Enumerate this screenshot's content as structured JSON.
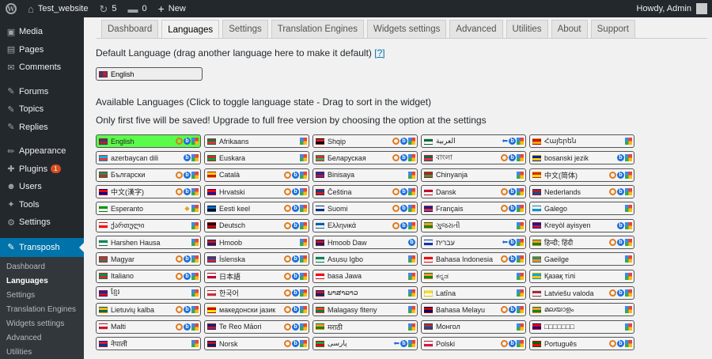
{
  "adminbar": {
    "site": "Test_website",
    "updates": "5",
    "comments": "0",
    "new": "New",
    "howdy": "Howdy, Admin"
  },
  "sidebar": {
    "items": [
      {
        "label": "Media",
        "icon": "media-icon",
        "glyph": "▣"
      },
      {
        "label": "Pages",
        "icon": "pages-icon",
        "glyph": "▤"
      },
      {
        "label": "Comments",
        "icon": "comments-icon",
        "glyph": "✉"
      },
      {
        "sep": true
      },
      {
        "label": "Forums",
        "icon": "forums-icon",
        "glyph": "✎"
      },
      {
        "label": "Topics",
        "icon": "topics-icon",
        "glyph": "✎"
      },
      {
        "label": "Replies",
        "icon": "replies-icon",
        "glyph": "✎"
      },
      {
        "sep": true
      },
      {
        "label": "Appearance",
        "icon": "appearance-icon",
        "glyph": "✏"
      },
      {
        "label": "Plugins",
        "icon": "plugins-icon",
        "glyph": "✚",
        "badge": "1"
      },
      {
        "label": "Users",
        "icon": "users-icon",
        "glyph": "☻"
      },
      {
        "label": "Tools",
        "icon": "tools-icon",
        "glyph": "✦"
      },
      {
        "label": "Settings",
        "icon": "settings-icon",
        "glyph": "⚙"
      },
      {
        "sep": true
      },
      {
        "label": "Transposh",
        "icon": "transposh-icon",
        "glyph": "✎",
        "current": true
      }
    ],
    "submenu": [
      {
        "label": "Dashboard"
      },
      {
        "label": "Languages",
        "current": true
      },
      {
        "label": "Settings"
      },
      {
        "label": "Translation Engines"
      },
      {
        "label": "Widgets settings"
      },
      {
        "label": "Advanced"
      },
      {
        "label": "Utilities"
      }
    ]
  },
  "tabs": [
    {
      "label": "Dashboard"
    },
    {
      "label": "Languages",
      "active": true
    },
    {
      "label": "Settings"
    },
    {
      "label": "Translation Engines"
    },
    {
      "label": "Widgets settings"
    },
    {
      "label": "Advanced"
    },
    {
      "label": "Utilities"
    },
    {
      "label": "About"
    },
    {
      "label": "Support"
    }
  ],
  "main": {
    "default_heading": "Default Language (drag another language here to make it default)",
    "default_help": "[?]",
    "default_language": "English",
    "available_heading": "Available Languages (Click to toggle language state - Drag to sort in the widget)",
    "notice": "Only first five will be saved! Upgrade to full free version by choosing the option at the settings"
  },
  "languages": [
    {
      "name": "English",
      "flag": [
        "#3c3b6e",
        "#b22234"
      ],
      "eng": "ybg",
      "sel": true
    },
    {
      "name": "Afrikaans",
      "flag": [
        "#007a4d",
        "#de3831"
      ],
      "eng": "g"
    },
    {
      "name": "Shqip",
      "flag": [
        "#e41e20",
        "#000000"
      ],
      "eng": "ybg"
    },
    {
      "name": "العربية",
      "flag": [
        "#006c35",
        "#ffffff"
      ],
      "eng": "rbg"
    },
    {
      "name": "Հայերեն",
      "flag": [
        "#d90012",
        "#f2a800"
      ],
      "eng": "g"
    },
    {
      "name": "azerbaycan dili",
      "flag": [
        "#00b5e2",
        "#ef3340"
      ],
      "eng": "bg"
    },
    {
      "name": "Euskara",
      "flag": [
        "#d52b1e",
        "#009b48"
      ],
      "eng": "g"
    },
    {
      "name": "Беларуская",
      "flag": [
        "#c8313e",
        "#4aa657"
      ],
      "eng": "ybg"
    },
    {
      "name": "বাংলা",
      "flag": [
        "#006a4e",
        "#f42a41"
      ],
      "eng": "ybg"
    },
    {
      "name": "bosanski jezik",
      "flag": [
        "#002395",
        "#fecb00"
      ],
      "eng": "bg"
    },
    {
      "name": "Български",
      "flag": [
        "#00966e",
        "#d62612"
      ],
      "eng": "ybg"
    },
    {
      "name": "Català",
      "flag": [
        "#fcdd09",
        "#da121a"
      ],
      "eng": "ybg"
    },
    {
      "name": "Binisaya",
      "flag": [
        "#0038a8",
        "#ce1126"
      ],
      "eng": "g"
    },
    {
      "name": "Chinyanja",
      "flag": [
        "#ce1126",
        "#339e35"
      ],
      "eng": "g"
    },
    {
      "name": "中文(简体)",
      "flag": [
        "#de2910",
        "#ffde00"
      ],
      "eng": "ybg"
    },
    {
      "name": "中文(漢字)",
      "flag": [
        "#fe0000",
        "#000095"
      ],
      "eng": "ybg"
    },
    {
      "name": "Hrvatski",
      "flag": [
        "#ff0000",
        "#171796"
      ],
      "eng": "ybg"
    },
    {
      "name": "Čeština",
      "flag": [
        "#11457e",
        "#d7141a"
      ],
      "eng": "ybg"
    },
    {
      "name": "Dansk",
      "flag": [
        "#c60c30",
        "#ffffff"
      ],
      "eng": "ybg"
    },
    {
      "name": "Nederlands",
      "flag": [
        "#ae1c28",
        "#21468b"
      ],
      "eng": "ybg"
    },
    {
      "name": "Esperanto",
      "flag": [
        "#009900",
        "#ffffff"
      ],
      "eng": "ag"
    },
    {
      "name": "Eesti keel",
      "flag": [
        "#0072ce",
        "#000000"
      ],
      "eng": "ybg"
    },
    {
      "name": "Suomi",
      "flag": [
        "#ffffff",
        "#003580"
      ],
      "eng": "ybg"
    },
    {
      "name": "Français",
      "flag": [
        "#002395",
        "#ed2939"
      ],
      "eng": "ybg"
    },
    {
      "name": "Galego",
      "flag": [
        "#ffffff",
        "#0099cc"
      ],
      "eng": "g"
    },
    {
      "name": "ქართული",
      "flag": [
        "#ffffff",
        "#ff0000"
      ],
      "eng": "g"
    },
    {
      "name": "Deutsch",
      "flag": [
        "#000000",
        "#dd0000"
      ],
      "eng": "ybg"
    },
    {
      "name": "Ελληνικά",
      "flag": [
        "#0d5eaf",
        "#ffffff"
      ],
      "eng": "ybg"
    },
    {
      "name": "ગુજરાતી",
      "flag": [
        "#ff9933",
        "#138808"
      ],
      "eng": "g"
    },
    {
      "name": "Kreyòl ayisyen",
      "flag": [
        "#00209f",
        "#d21034"
      ],
      "eng": "bg"
    },
    {
      "name": "Harshen Hausa",
      "flag": [
        "#008751",
        "#ffffff"
      ],
      "eng": "g"
    },
    {
      "name": "Hmoob",
      "flag": [
        "#ce1126",
        "#002868"
      ],
      "eng": "g"
    },
    {
      "name": "Hmoob Daw",
      "flag": [
        "#ce1126",
        "#002868"
      ],
      "eng": "b"
    },
    {
      "name": "עברית",
      "flag": [
        "#ffffff",
        "#0038b8"
      ],
      "eng": "rbg"
    },
    {
      "name": "हिन्दी; हिंदी",
      "flag": [
        "#ff9933",
        "#138808"
      ],
      "eng": "ybg"
    },
    {
      "name": "Magyar",
      "flag": [
        "#ce2939",
        "#477050"
      ],
      "eng": "ybg"
    },
    {
      "name": "Íslenska",
      "flag": [
        "#02529c",
        "#dc1e35"
      ],
      "eng": "ybg"
    },
    {
      "name": "Asụsụ Igbo",
      "flag": [
        "#008751",
        "#ffffff"
      ],
      "eng": "g"
    },
    {
      "name": "Bahasa Indonesia",
      "flag": [
        "#ff0000",
        "#ffffff"
      ],
      "eng": "ybg"
    },
    {
      "name": "Gaeilge",
      "flag": [
        "#169b62",
        "#ff883e"
      ],
      "eng": "g"
    },
    {
      "name": "Italiano",
      "flag": [
        "#009246",
        "#ce2b37"
      ],
      "eng": "ybg"
    },
    {
      "name": "日本語",
      "flag": [
        "#ffffff",
        "#bc002d"
      ],
      "eng": "ybg"
    },
    {
      "name": "basa Jawa",
      "flag": [
        "#ff0000",
        "#ffffff"
      ],
      "eng": "g"
    },
    {
      "name": "ಕನ್ನಡ",
      "flag": [
        "#ff9933",
        "#138808"
      ],
      "eng": "g"
    },
    {
      "name": "Қазақ тілі",
      "flag": [
        "#00afca",
        "#fec50c"
      ],
      "eng": "g"
    },
    {
      "name": "ខ្មែរ",
      "flag": [
        "#032ea1",
        "#e00025"
      ],
      "eng": "g"
    },
    {
      "name": "한국어",
      "flag": [
        "#ffffff",
        "#cd2e3a"
      ],
      "eng": "ybg"
    },
    {
      "name": "ພາສາລາວ",
      "flag": [
        "#ce1126",
        "#002868"
      ],
      "eng": "g"
    },
    {
      "name": "Latīna",
      "flag": [
        "#ffe000",
        "#ffffff"
      ],
      "eng": "g"
    },
    {
      "name": "Latviešu valoda",
      "flag": [
        "#9e3039",
        "#ffffff"
      ],
      "eng": "ybg"
    },
    {
      "name": "Lietuvių kalba",
      "flag": [
        "#fdb913",
        "#006a44"
      ],
      "eng": "ybg"
    },
    {
      "name": "македонски јазик",
      "flag": [
        "#d20000",
        "#ffe600"
      ],
      "eng": "ybg"
    },
    {
      "name": "Malagasy fiteny",
      "flag": [
        "#fc3d32",
        "#007e3a"
      ],
      "eng": "g"
    },
    {
      "name": "Bahasa Melayu",
      "flag": [
        "#cc0001",
        "#010066"
      ],
      "eng": "ybg"
    },
    {
      "name": "മലയാളം",
      "flag": [
        "#ff9933",
        "#138808"
      ],
      "eng": "g"
    },
    {
      "name": "Malti",
      "flag": [
        "#ffffff",
        "#cf142b"
      ],
      "eng": "ybg"
    },
    {
      "name": "Te Reo Māori",
      "flag": [
        "#00247d",
        "#cc142b"
      ],
      "eng": "ybg"
    },
    {
      "name": "मराठी",
      "flag": [
        "#ff9933",
        "#138808"
      ],
      "eng": "g"
    },
    {
      "name": "Монгол",
      "flag": [
        "#c4272f",
        "#015197"
      ],
      "eng": "g"
    },
    {
      "name": "□□□□□□□",
      "flag": [
        "#fe0000",
        "#000095"
      ],
      "eng": "g"
    },
    {
      "name": "नेपाली",
      "flag": [
        "#dc143c",
        "#003893"
      ],
      "eng": "g"
    },
    {
      "name": "Norsk",
      "flag": [
        "#ba0c2f",
        "#00205b"
      ],
      "eng": "ybg"
    },
    {
      "name": "پارسی",
      "flag": [
        "#239f40",
        "#da0000"
      ],
      "eng": "rbg"
    },
    {
      "name": "Polski",
      "flag": [
        "#ffffff",
        "#dc143c"
      ],
      "eng": "ybg"
    },
    {
      "name": "Português",
      "flag": [
        "#006600",
        "#ff0000"
      ],
      "eng": "ybg"
    }
  ]
}
